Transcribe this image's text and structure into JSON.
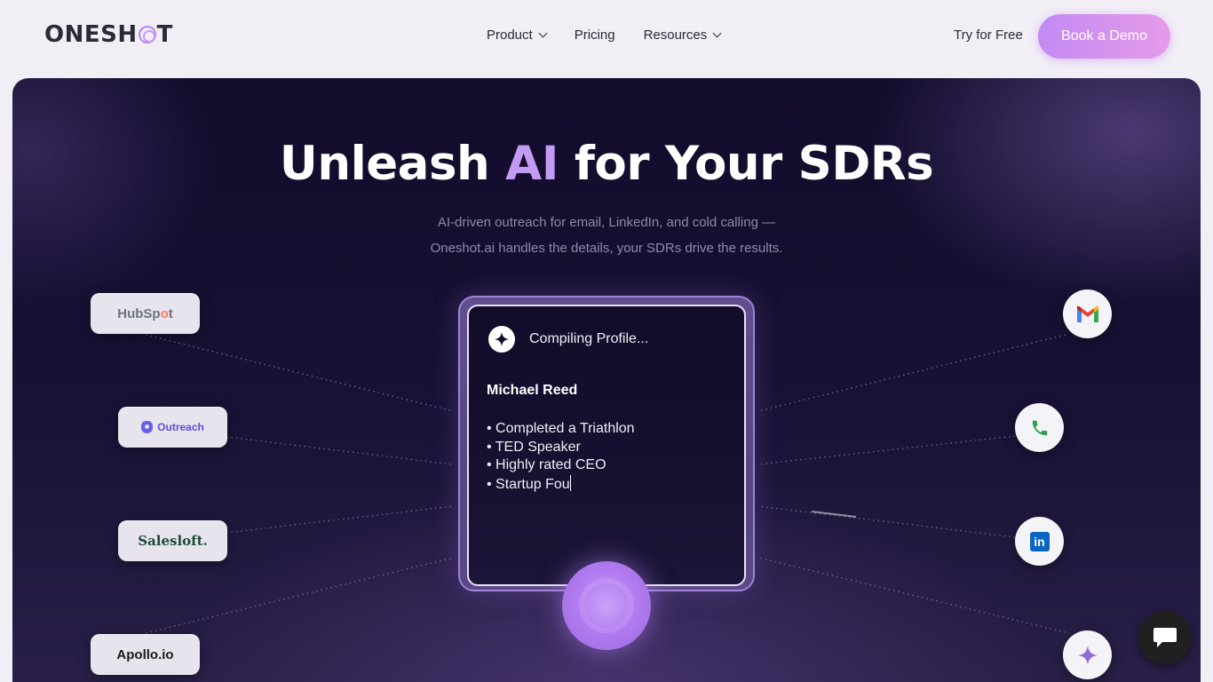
{
  "nav": {
    "logo_pre": "ONESH",
    "logo_post": "T",
    "items": [
      {
        "label": "Product"
      },
      {
        "label": "Pricing"
      },
      {
        "label": "Resources"
      }
    ],
    "try_label": "Try for Free",
    "demo_label": "Book a Demo"
  },
  "hero": {
    "title_pre": "Unleash ",
    "title_accent": "AI",
    "title_post": " for Your SDRs",
    "subtitle_line1": "AI-driven outreach for email, LinkedIn, and cold calling —",
    "subtitle_line2": "Oneshot.ai handles the details, your SDRs drive the results."
  },
  "integrations_left": [
    {
      "name": "HubSpot",
      "pre": "HubSp",
      "mid": "o",
      "post": "t"
    },
    {
      "name": "Outreach"
    },
    {
      "name": "Salesloft."
    },
    {
      "name": "Apollo.io"
    }
  ],
  "channels_right": [
    "gmail-icon",
    "phone-icon",
    "linkedin-icon",
    "sparkle-icon"
  ],
  "card": {
    "status": "Compiling Profile...",
    "name": "Michael Reed",
    "bullets": [
      "Completed a Triathlon",
      "TED Speaker",
      "Highly rated CEO",
      "Startup Fou"
    ]
  },
  "colors": {
    "accent": "#c39bf5",
    "button_gradient_start": "#c38af5",
    "button_gradient_end": "#e59be8",
    "hero_bg": "#120b2a"
  }
}
